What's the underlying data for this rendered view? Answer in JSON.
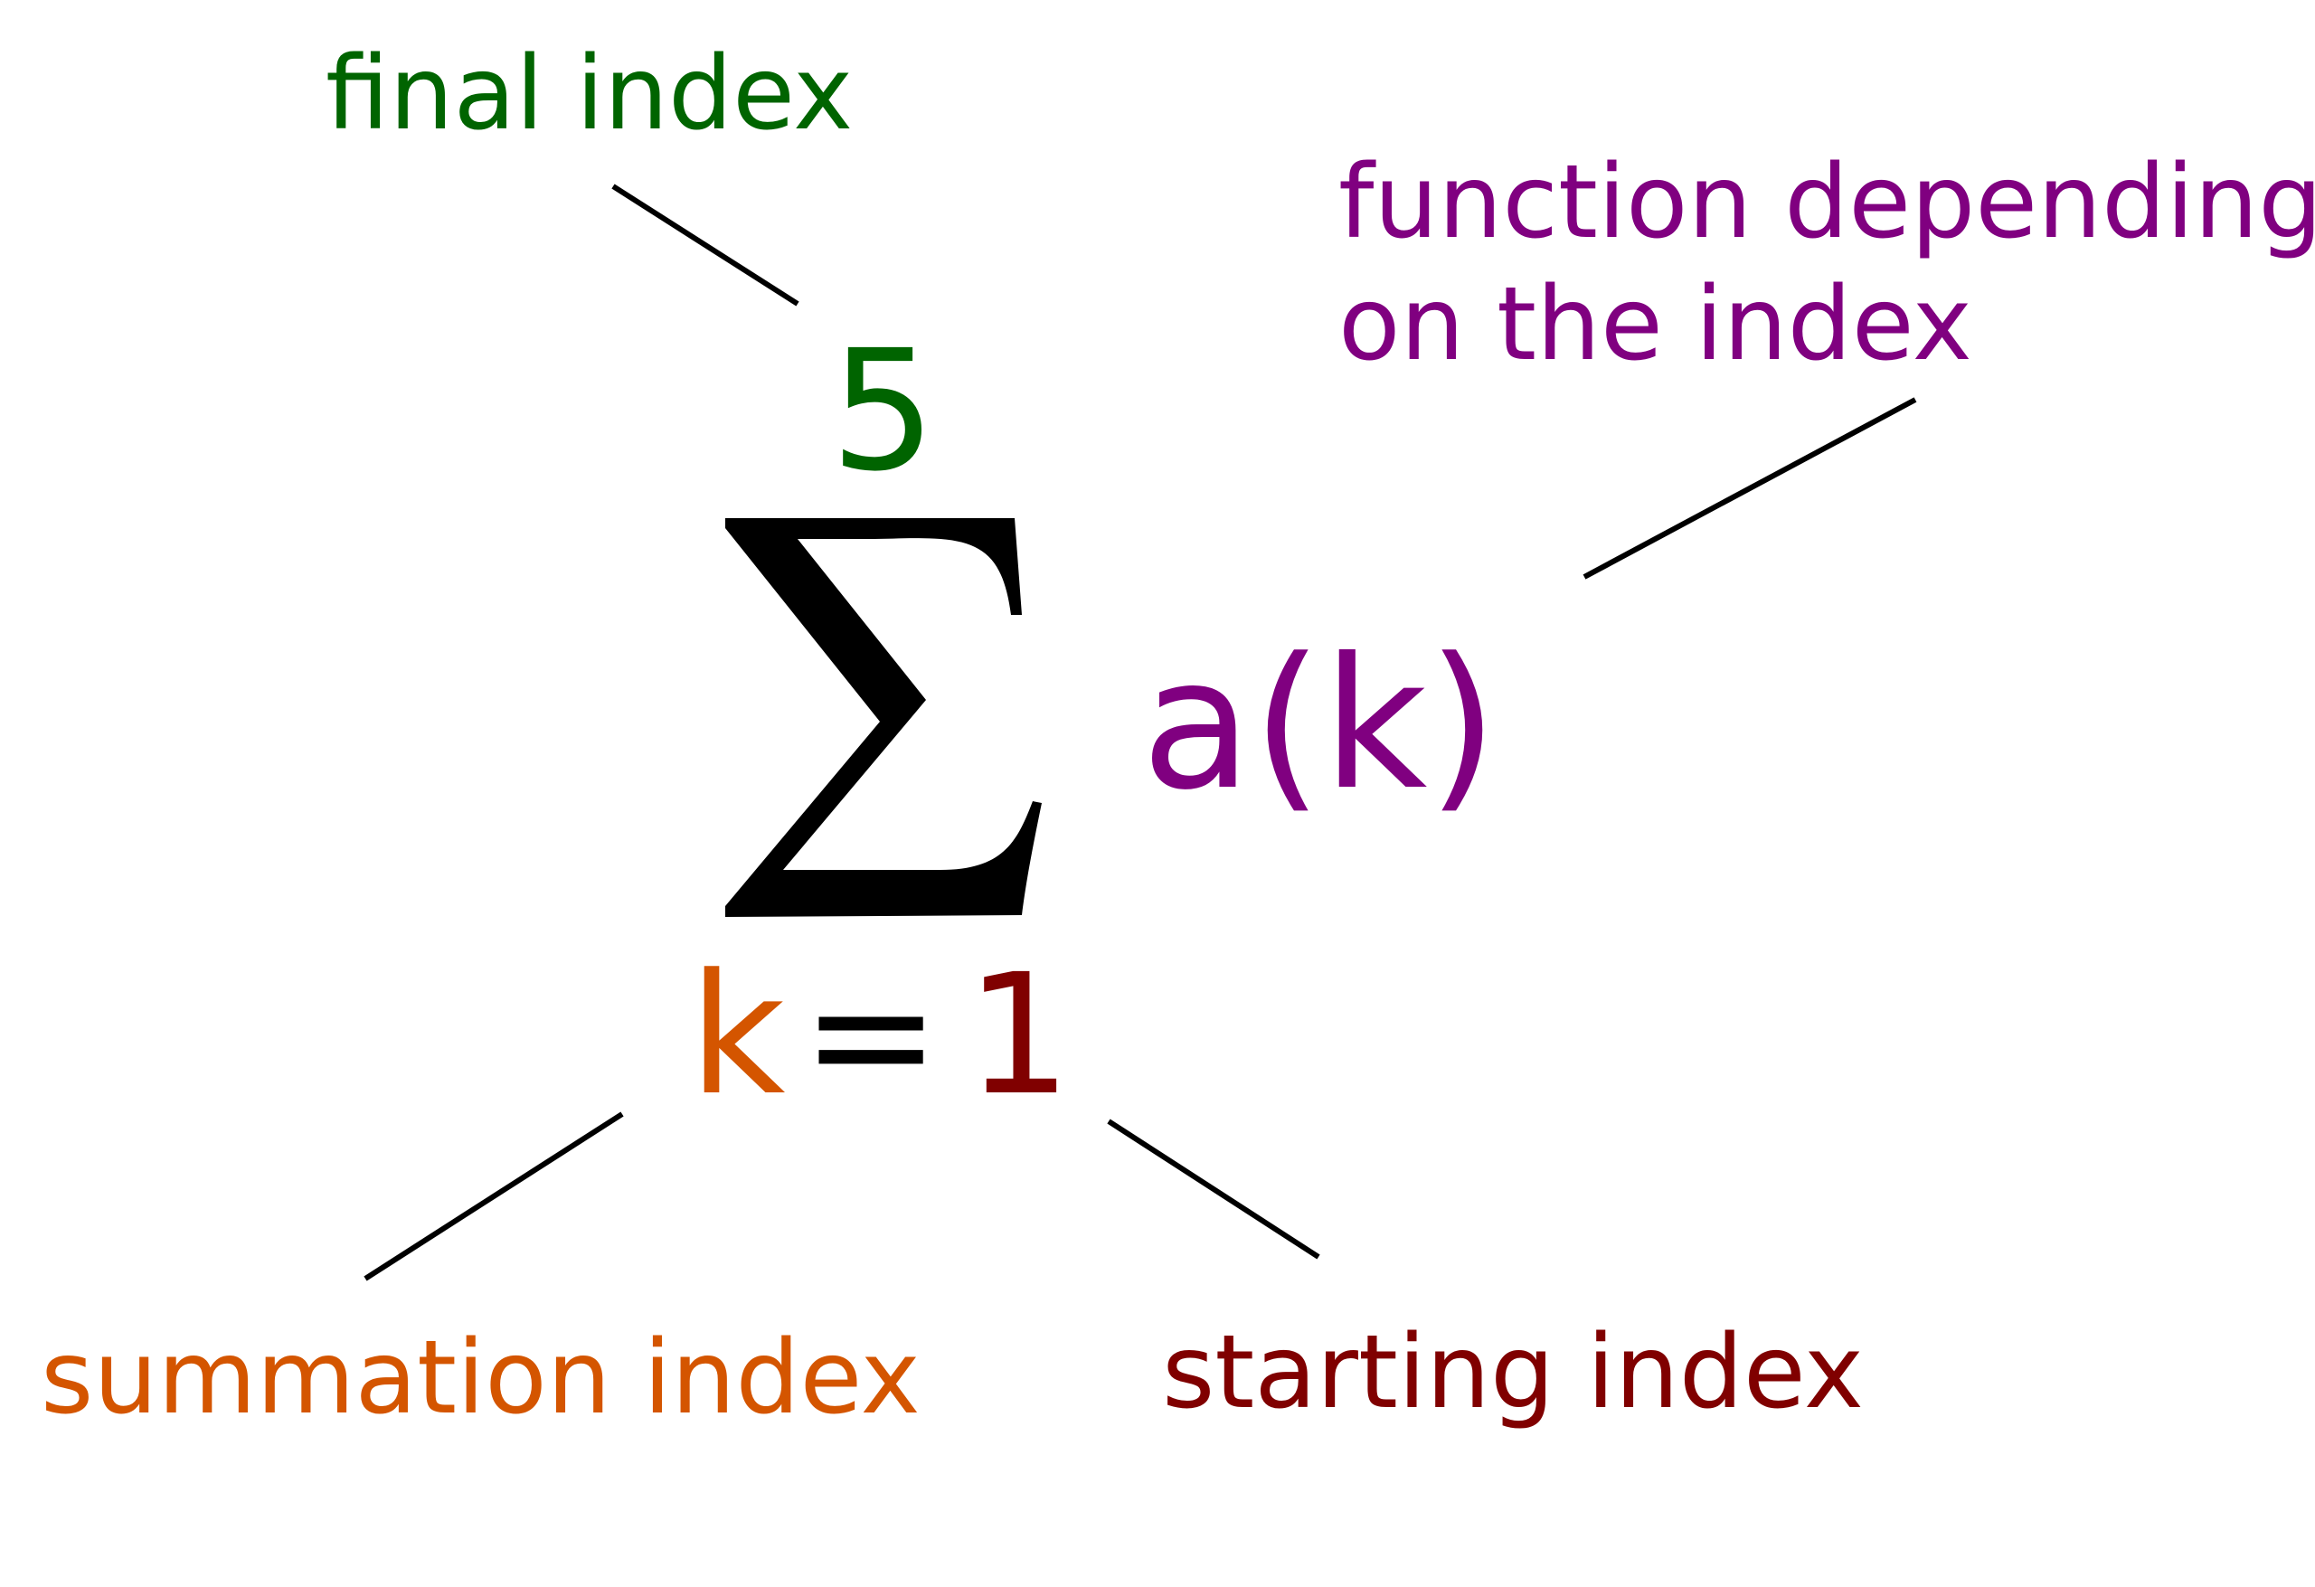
{
  "colors": {
    "final": "#006400",
    "function": "#800080",
    "summation": "#D45500",
    "starting": "#800000",
    "operator": "#000000"
  },
  "formula": {
    "upper_bound": "5",
    "operator_symbol": "Σ",
    "index_variable": "k",
    "equals": "=",
    "lower_bound": "1",
    "term": "a(k)"
  },
  "labels": {
    "final_index": "final index",
    "function_line1": "function depending",
    "function_line2": "on the index",
    "summation_index": "summation index",
    "starting_index": "starting index"
  }
}
